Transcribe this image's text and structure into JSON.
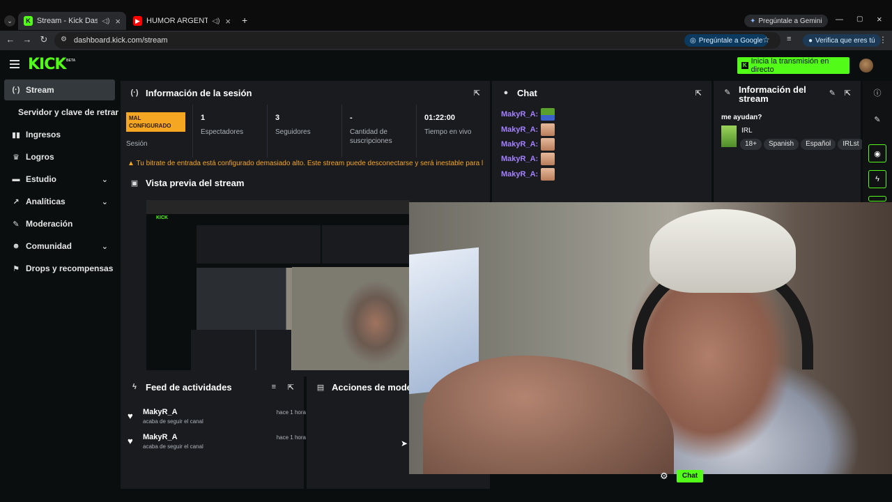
{
  "browser": {
    "tabs": [
      {
        "title": "Stream - Kick Dashboard",
        "active": true
      },
      {
        "title": "HUMOR ARGENTINO:Comedia",
        "active": false
      }
    ],
    "new_tab": "+",
    "gemini": "Pregúntale a Gemini",
    "url": "dashboard.kick.com/stream",
    "ask_google": "Pregúntale a Google",
    "verify": "Verifica que eres tú"
  },
  "app": {
    "logo": "KICK",
    "beta": "BETA",
    "go_live": "Inicia la transmisión en directo"
  },
  "sidebar": {
    "items": [
      {
        "label": "Stream",
        "icon": "(·)"
      },
      {
        "label": "Servidor y clave de retransmisión"
      },
      {
        "label": "Ingresos",
        "icon": "▮"
      },
      {
        "label": "Logros",
        "icon": "🏆"
      },
      {
        "label": "Estudio",
        "icon": "▬"
      },
      {
        "label": "Analíticas",
        "icon": "📈"
      },
      {
        "label": "Moderación",
        "icon": "🔧"
      },
      {
        "label": "Comunidad",
        "icon": "👥"
      },
      {
        "label": "Drops y recompensas",
        "icon": "⚑"
      }
    ]
  },
  "session": {
    "title": "Información de la sesión",
    "status": "MAL CONFIGURADO",
    "status_label": "Sesión",
    "viewers": "1",
    "viewers_label": "Espectadores",
    "followers": "3",
    "followers_label": "Seguidores",
    "subs": "-",
    "subs_label": "Cantidad de suscripciones",
    "uptime": "01:22:00",
    "uptime_label": "Tiempo en vivo",
    "warning": "Tu bitrate de entrada está configurado demasiado alto. Este stream puede desconectarse y será inestable para los espectadores"
  },
  "preview": {
    "title": "Vista previa del stream"
  },
  "chat": {
    "title": "Chat",
    "messages": [
      "MakyR_A:",
      "MakyR_A:",
      "MakyR_A:",
      "MakyR_A:",
      "MakyR_A:"
    ],
    "send": "Chat"
  },
  "stream_info": {
    "title": "Información del stream",
    "stream_title": "me ayudan?",
    "category": "IRL",
    "tags": [
      "18+",
      "Spanish",
      "Español",
      "IRLst"
    ]
  },
  "feed": {
    "title": "Feed de actividades",
    "items": [
      {
        "name": "MakyR_A",
        "action": "acaba de seguir el canal",
        "time": "hace 1 hora"
      },
      {
        "name": "MakyR_A",
        "action": "acaba de seguir el canal",
        "time": "hace 1 hora"
      }
    ]
  },
  "mod_actions": {
    "title": "Acciones de moder"
  },
  "colors": {
    "kick_green": "#53fc18",
    "warning": "#f5a623",
    "panel": "#191b1f",
    "chat_name": "#a480ff"
  }
}
